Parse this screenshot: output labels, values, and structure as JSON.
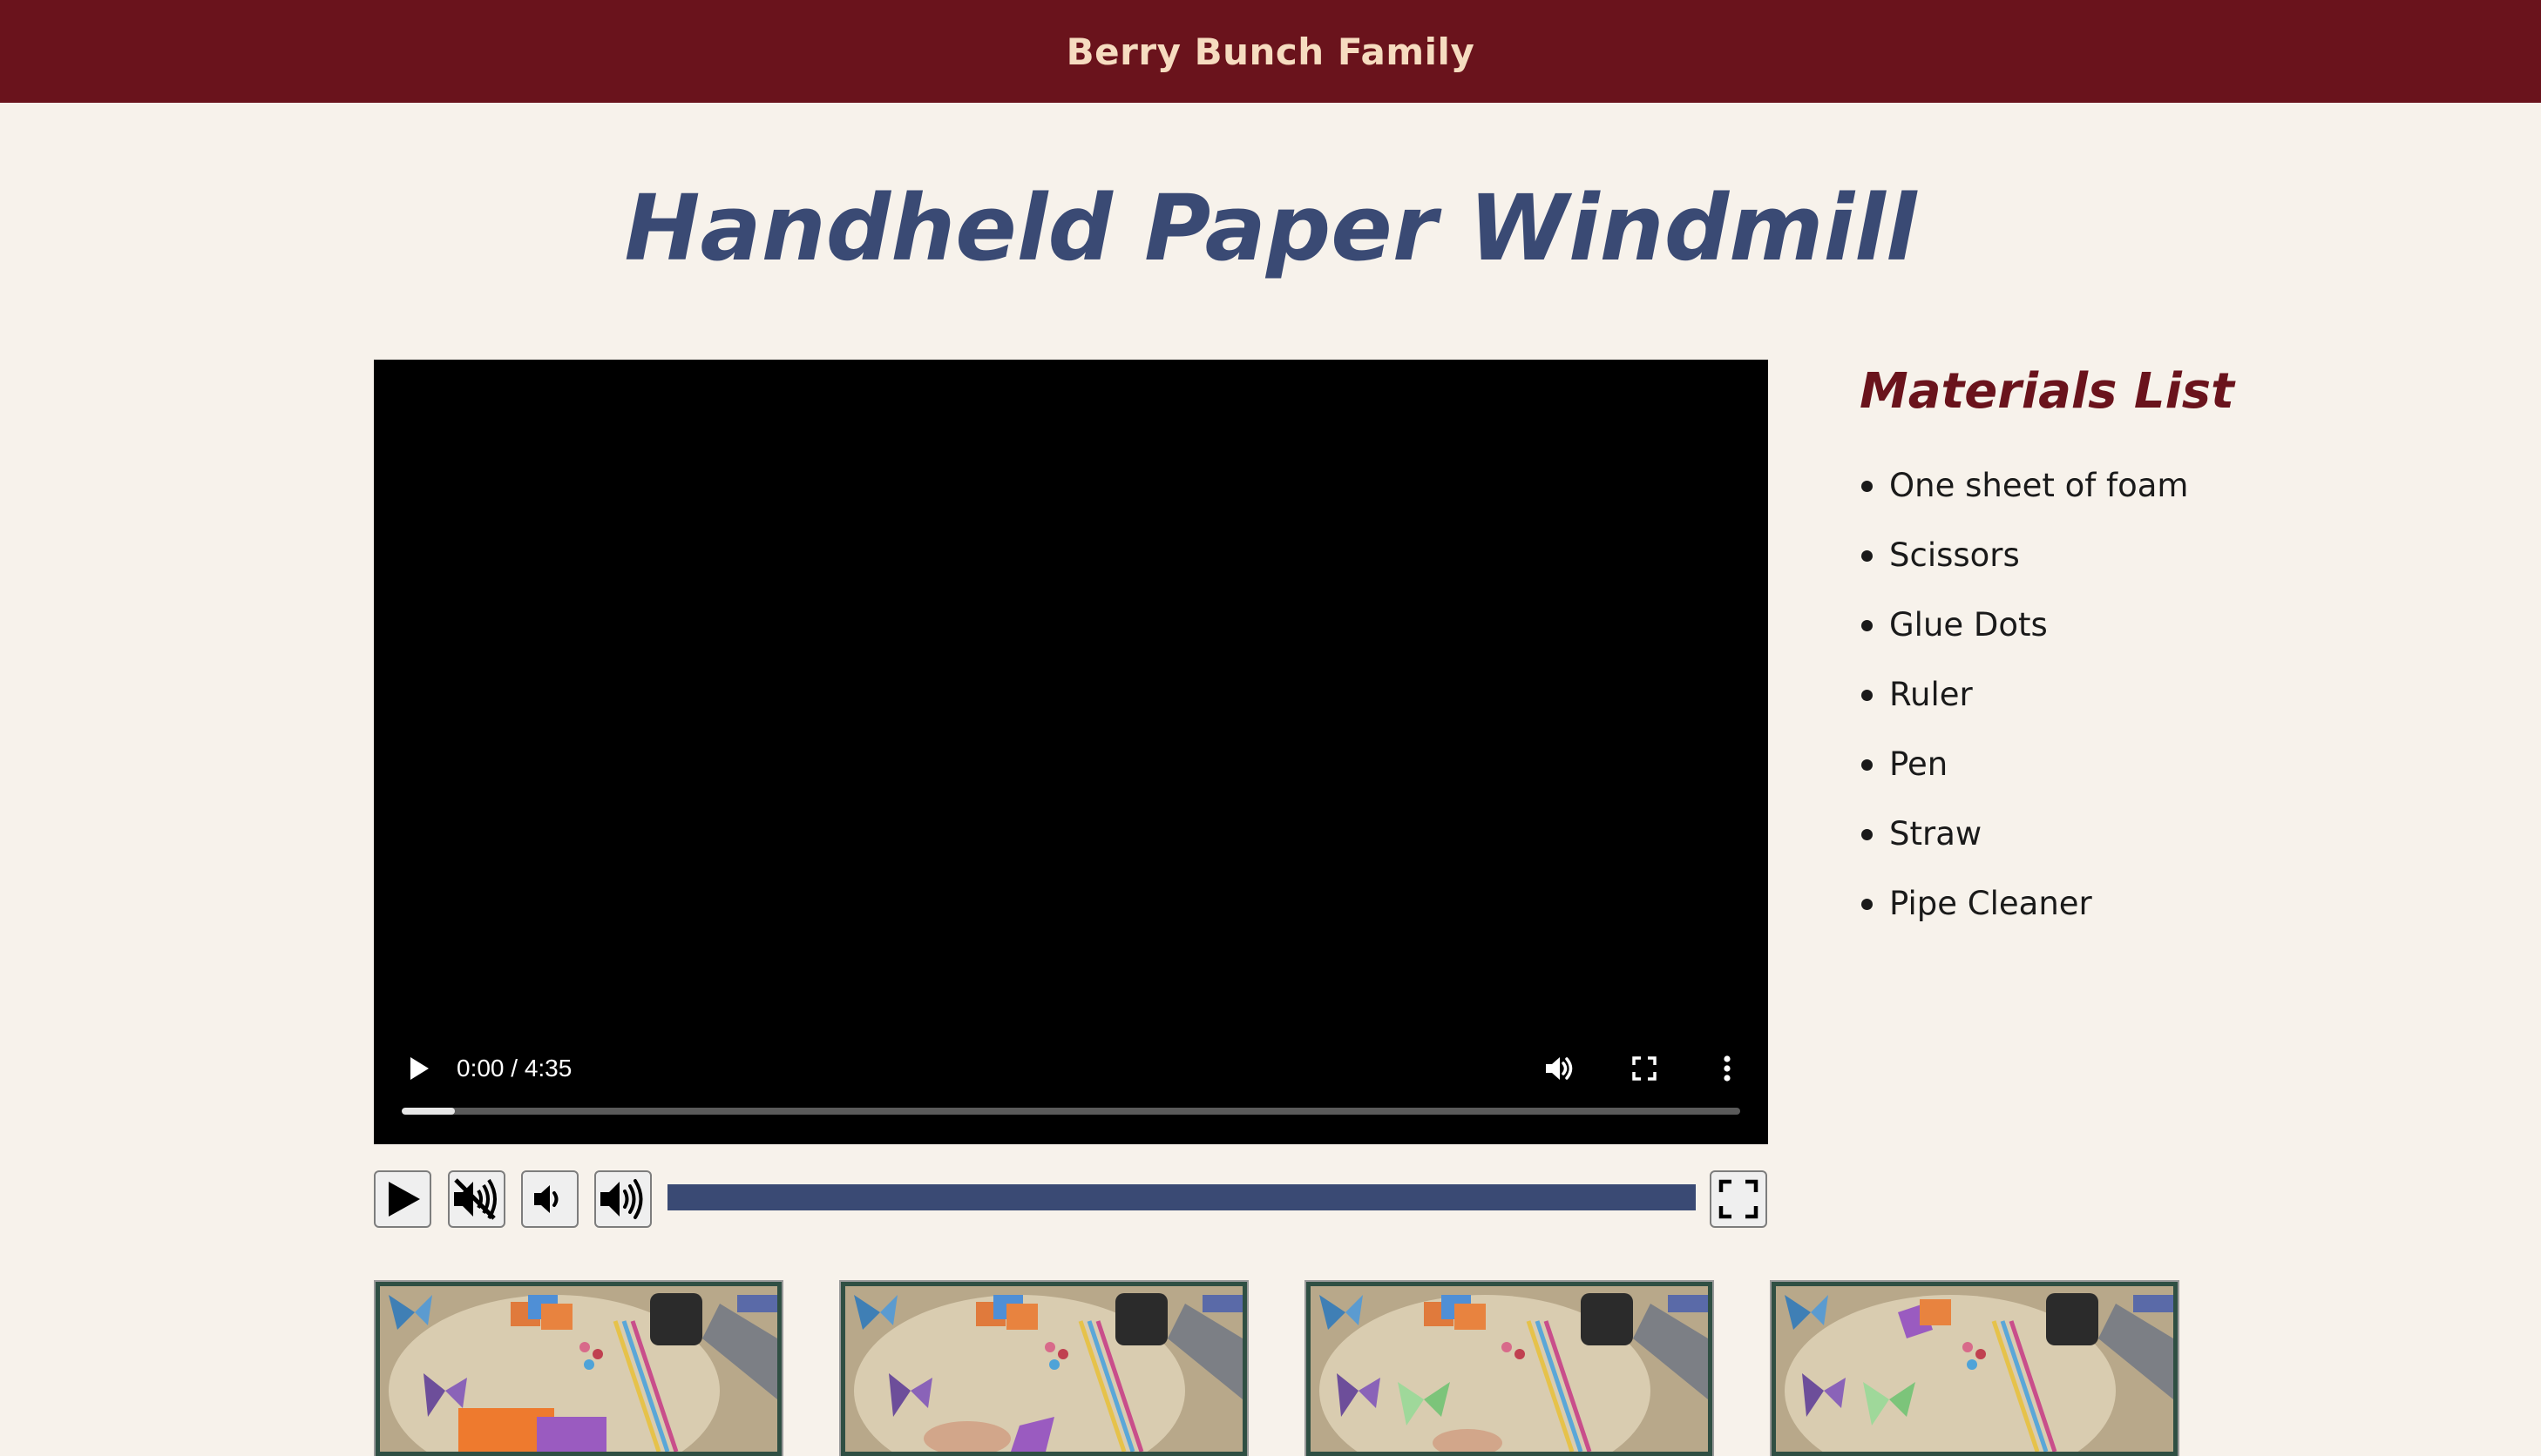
{
  "header": {
    "site_name": "Berry Bunch Family"
  },
  "page": {
    "title": "Handheld Paper Windmill"
  },
  "video_player": {
    "time_display": "0:00 / 4:35",
    "played_fraction": 0.04
  },
  "custom_controls": {
    "buttons": [
      {
        "name": "play-button",
        "icon": "play-icon"
      },
      {
        "name": "mute-button",
        "icon": "muted-speaker-icon"
      },
      {
        "name": "volume-down-button",
        "icon": "volume-low-icon"
      },
      {
        "name": "volume-up-button",
        "icon": "volume-high-icon"
      }
    ],
    "fullscreen_icon": "fullscreen-icon"
  },
  "materials": {
    "heading": "Materials List",
    "items": [
      "One sheet of foam",
      "Scissors",
      "Glue Dots",
      "Ruler",
      "Pen",
      "Straw",
      "Pipe Cleaner"
    ]
  },
  "thumbnails": [
    {
      "name": "step-1-thumbnail"
    },
    {
      "name": "step-2-thumbnail"
    },
    {
      "name": "step-3-thumbnail"
    },
    {
      "name": "step-4-thumbnail"
    }
  ],
  "colors": {
    "header_bg": "#6a131c",
    "site_name": "#f6dcc0",
    "title": "#3a4a74",
    "materials_heading": "#6a131c",
    "page_bg": "#f7f2eb",
    "progress": "#3a4a74",
    "thumb_border": "#2f4f43"
  }
}
